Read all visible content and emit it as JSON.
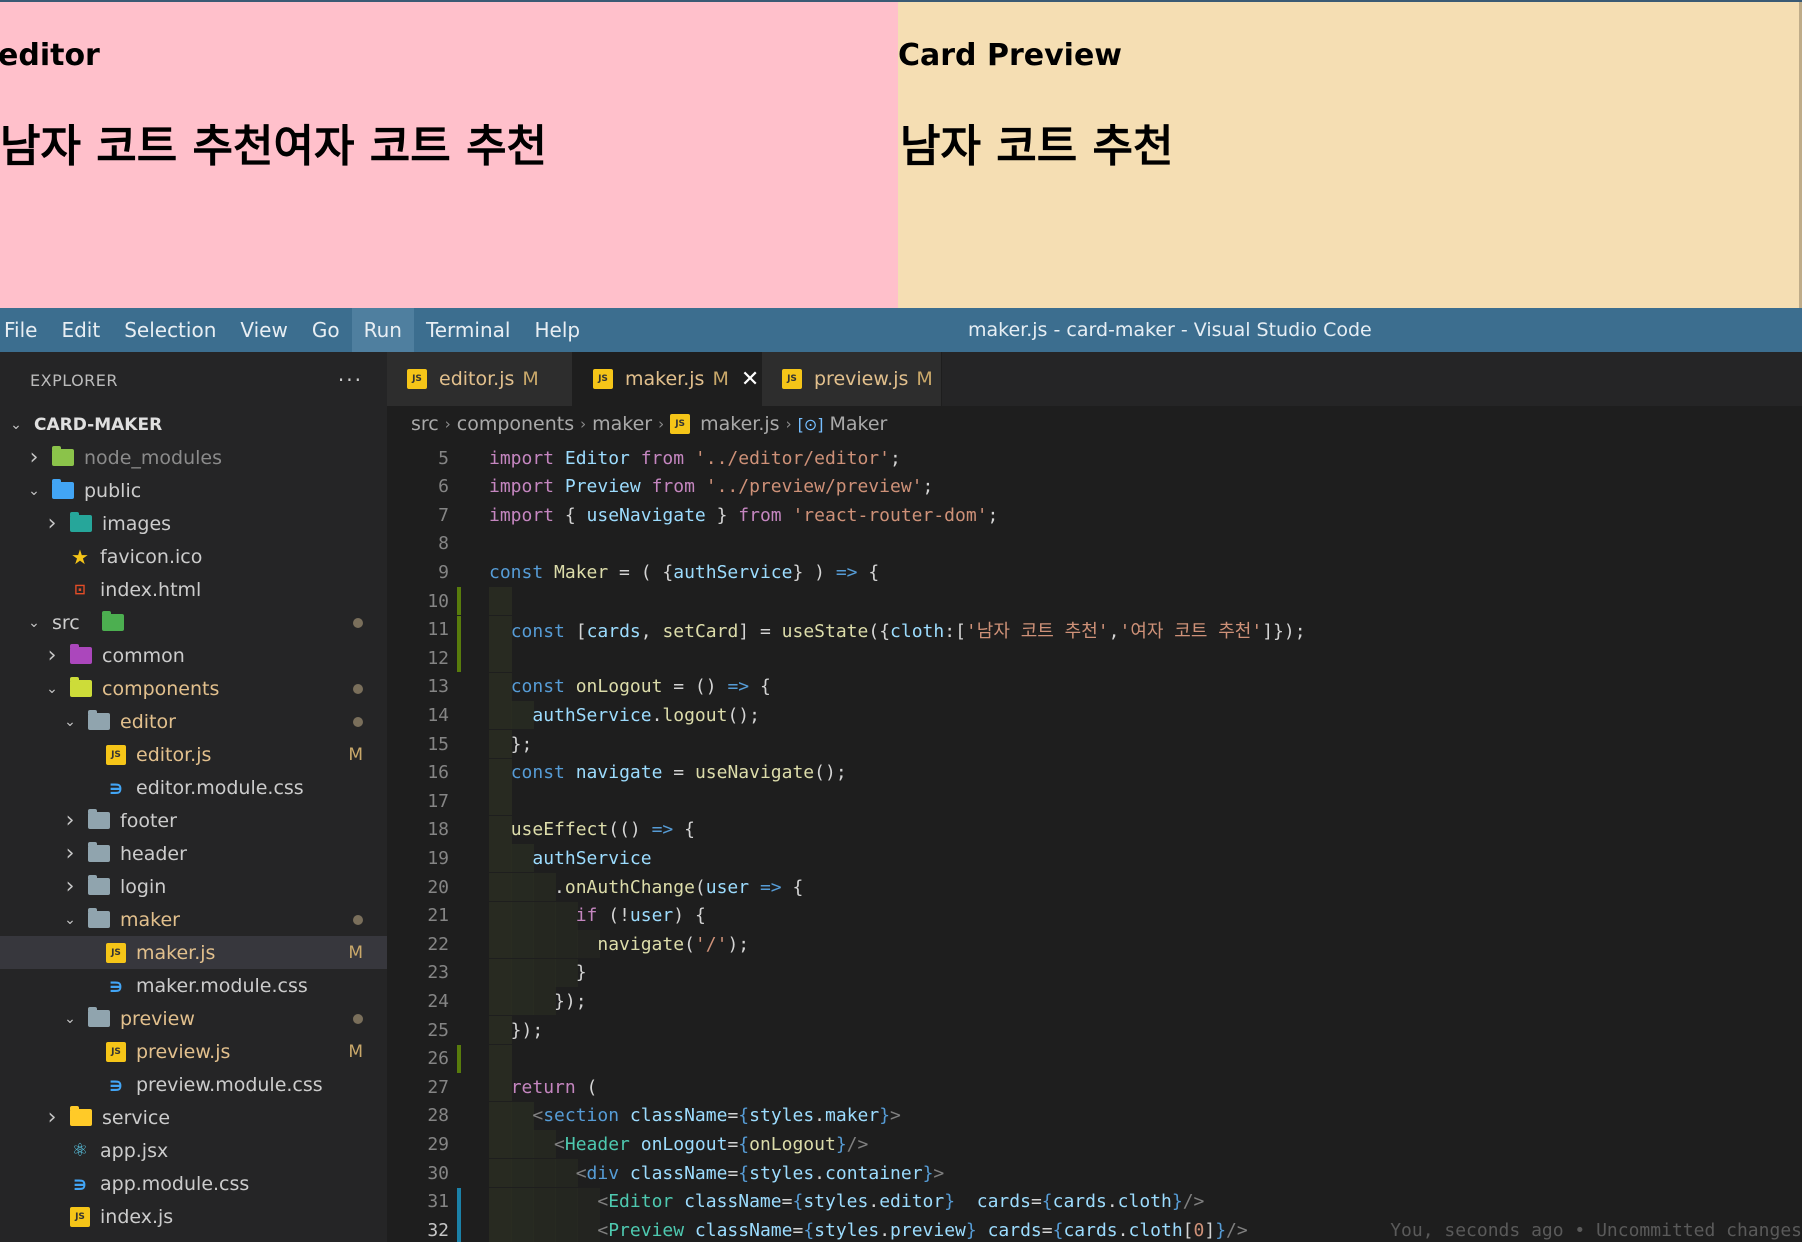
{
  "browser_preview": {
    "editor": {
      "heading": "editor",
      "content": "남자 코트 추천여자 코트 추천"
    },
    "preview": {
      "heading": "Card Preview",
      "content": "남자 코트 추천"
    }
  },
  "titlebar": {
    "menu": [
      "File",
      "Edit",
      "Selection",
      "View",
      "Go",
      "Run",
      "Terminal",
      "Help"
    ],
    "active_menu": "Run",
    "window_title": "maker.js - card-maker - Visual Studio Code"
  },
  "explorer": {
    "title": "EXPLORER",
    "more": "···",
    "root": "CARD-MAKER",
    "items": [
      {
        "label": "node_modules",
        "depth": 1,
        "kind": "folder",
        "color": "green",
        "expanded": false
      },
      {
        "label": "public",
        "depth": 1,
        "kind": "folder",
        "color": "blue",
        "expanded": true
      },
      {
        "label": "images",
        "depth": 2,
        "kind": "folder",
        "color": "teal",
        "expanded": false
      },
      {
        "label": "favicon.ico",
        "depth": 2,
        "kind": "star"
      },
      {
        "label": "index.html",
        "depth": 2,
        "kind": "html"
      },
      {
        "label": "src",
        "depth": 1,
        "kind": "folder",
        "color": "src",
        "expanded": true,
        "dot": true
      },
      {
        "label": "common",
        "depth": 2,
        "kind": "folder",
        "color": "purple",
        "expanded": false
      },
      {
        "label": "components",
        "depth": 2,
        "kind": "folder",
        "color": "yellow",
        "expanded": true,
        "dot": true,
        "modified_color": true
      },
      {
        "label": "editor",
        "depth": 3,
        "kind": "folder",
        "color": "plain",
        "expanded": true,
        "dot": true,
        "modified_color": true
      },
      {
        "label": "editor.js",
        "depth": 4,
        "kind": "js",
        "badge": "M",
        "modified_color": true
      },
      {
        "label": "editor.module.css",
        "depth": 4,
        "kind": "css"
      },
      {
        "label": "footer",
        "depth": 3,
        "kind": "folder",
        "color": "plain",
        "expanded": false
      },
      {
        "label": "header",
        "depth": 3,
        "kind": "folder",
        "color": "plain",
        "expanded": false
      },
      {
        "label": "login",
        "depth": 3,
        "kind": "folder",
        "color": "plain",
        "expanded": false
      },
      {
        "label": "maker",
        "depth": 3,
        "kind": "folder",
        "color": "plain",
        "expanded": true,
        "dot": true,
        "modified_color": true
      },
      {
        "label": "maker.js",
        "depth": 4,
        "kind": "js",
        "badge": "M",
        "modified_color": true,
        "selected": true
      },
      {
        "label": "maker.module.css",
        "depth": 4,
        "kind": "css"
      },
      {
        "label": "preview",
        "depth": 3,
        "kind": "folder",
        "color": "plain",
        "expanded": true,
        "dot": true,
        "modified_color": true
      },
      {
        "label": "preview.js",
        "depth": 4,
        "kind": "js",
        "badge": "M",
        "modified_color": true
      },
      {
        "label": "preview.module.css",
        "depth": 4,
        "kind": "css"
      },
      {
        "label": "service",
        "depth": 2,
        "kind": "folder",
        "color": "gold",
        "expanded": false
      },
      {
        "label": "app.jsx",
        "depth": 2,
        "kind": "react"
      },
      {
        "label": "app.module.css",
        "depth": 2,
        "kind": "css"
      },
      {
        "label": "index.js",
        "depth": 2,
        "kind": "js"
      }
    ]
  },
  "tabs": [
    {
      "label": "editor.js",
      "flag": "M",
      "active": false
    },
    {
      "label": "maker.js",
      "flag": "M",
      "active": true,
      "close": "✕"
    },
    {
      "label": "preview.js",
      "flag": "M",
      "active": false
    }
  ],
  "breadcrumb": {
    "parts": [
      "src",
      "components",
      "maker",
      "maker.js"
    ],
    "symbol": "Maker"
  },
  "code": {
    "current_line": 32,
    "blame": "You, seconds ago • Uncommitted changes",
    "lines": [
      {
        "n": 5,
        "tokens": [
          [
            "kw",
            "import "
          ],
          [
            "var",
            "Editor "
          ],
          [
            "kw",
            "from "
          ],
          [
            "str",
            "'../editor/editor'"
          ],
          [
            "pn",
            ";"
          ]
        ]
      },
      {
        "n": 6,
        "tokens": [
          [
            "kw",
            "import "
          ],
          [
            "var",
            "Preview "
          ],
          [
            "kw",
            "from "
          ],
          [
            "str",
            "'../preview/preview'"
          ],
          [
            "pn",
            ";"
          ]
        ]
      },
      {
        "n": 7,
        "tokens": [
          [
            "kw",
            "import "
          ],
          [
            "pn",
            "{ "
          ],
          [
            "var",
            "useNavigate"
          ],
          [
            "pn",
            " } "
          ],
          [
            "kw",
            "from "
          ],
          [
            "str",
            "'react-router-dom'"
          ],
          [
            "pn",
            ";"
          ]
        ]
      },
      {
        "n": 8,
        "tokens": []
      },
      {
        "n": 9,
        "tokens": [
          [
            "kd",
            "const "
          ],
          [
            "fn",
            "Maker"
          ],
          [
            "pn",
            " = ( {"
          ],
          [
            "var",
            "authService"
          ],
          [
            "pn",
            "} ) "
          ],
          [
            "kd",
            "=>"
          ],
          [
            "pn",
            " {"
          ]
        ]
      },
      {
        "n": 10,
        "tokens": []
      },
      {
        "n": 11,
        "tokens": [
          [
            "pn",
            "  "
          ],
          [
            "kd",
            "const "
          ],
          [
            "pn",
            "["
          ],
          [
            "var",
            "cards"
          ],
          [
            "pn",
            ", "
          ],
          [
            "fn",
            "setCard"
          ],
          [
            "pn",
            "] = "
          ],
          [
            "fn",
            "useState"
          ],
          [
            "pn",
            "({"
          ],
          [
            "var",
            "cloth"
          ],
          [
            "pn",
            ":["
          ],
          [
            "str",
            "'남자 코트 추천'"
          ],
          [
            "pn",
            ","
          ],
          [
            "str",
            "'여자 코트 추천'"
          ],
          [
            "pn",
            "]});"
          ]
        ]
      },
      {
        "n": 12,
        "tokens": []
      },
      {
        "n": 13,
        "tokens": [
          [
            "pn",
            "  "
          ],
          [
            "kd",
            "const "
          ],
          [
            "fn",
            "onLogout"
          ],
          [
            "pn",
            " = () "
          ],
          [
            "kd",
            "=>"
          ],
          [
            "pn",
            " {"
          ]
        ]
      },
      {
        "n": 14,
        "tokens": [
          [
            "pn",
            "    "
          ],
          [
            "var",
            "authService"
          ],
          [
            "pn",
            "."
          ],
          [
            "fn",
            "logout"
          ],
          [
            "pn",
            "();"
          ]
        ]
      },
      {
        "n": 15,
        "tokens": [
          [
            "pn",
            "  };"
          ]
        ]
      },
      {
        "n": 16,
        "tokens": [
          [
            "pn",
            "  "
          ],
          [
            "kd",
            "const "
          ],
          [
            "var",
            "navigate"
          ],
          [
            "pn",
            " = "
          ],
          [
            "fn",
            "useNavigate"
          ],
          [
            "pn",
            "();"
          ]
        ]
      },
      {
        "n": 17,
        "tokens": []
      },
      {
        "n": 18,
        "tokens": [
          [
            "pn",
            "  "
          ],
          [
            "fn",
            "useEffect"
          ],
          [
            "pn",
            "(() "
          ],
          [
            "kd",
            "=>"
          ],
          [
            "pn",
            " {"
          ]
        ]
      },
      {
        "n": 19,
        "tokens": [
          [
            "pn",
            "    "
          ],
          [
            "var",
            "authService"
          ]
        ]
      },
      {
        "n": 20,
        "tokens": [
          [
            "pn",
            "      ."
          ],
          [
            "fn",
            "onAuthChange"
          ],
          [
            "pn",
            "("
          ],
          [
            "var",
            "user"
          ],
          [
            "pn",
            " "
          ],
          [
            "kd",
            "=>"
          ],
          [
            "pn",
            " {"
          ]
        ]
      },
      {
        "n": 21,
        "tokens": [
          [
            "pn",
            "        "
          ],
          [
            "kw",
            "if"
          ],
          [
            "pn",
            " (!"
          ],
          [
            "var",
            "user"
          ],
          [
            "pn",
            ") {"
          ]
        ]
      },
      {
        "n": 22,
        "tokens": [
          [
            "pn",
            "          "
          ],
          [
            "fn",
            "navigate"
          ],
          [
            "pn",
            "("
          ],
          [
            "str",
            "'/'"
          ],
          [
            "pn",
            ");"
          ]
        ]
      },
      {
        "n": 23,
        "tokens": [
          [
            "pn",
            "        }"
          ]
        ]
      },
      {
        "n": 24,
        "tokens": [
          [
            "pn",
            "      });"
          ]
        ]
      },
      {
        "n": 25,
        "tokens": [
          [
            "pn",
            "  });"
          ]
        ]
      },
      {
        "n": 26,
        "tokens": []
      },
      {
        "n": 27,
        "tokens": [
          [
            "pn",
            "  "
          ],
          [
            "kw",
            "return"
          ],
          [
            "pn",
            " ("
          ]
        ]
      },
      {
        "n": 28,
        "tokens": [
          [
            "pn",
            "    "
          ],
          [
            "tag",
            "<"
          ],
          [
            "kd",
            "section "
          ],
          [
            "var",
            "className"
          ],
          [
            "pn",
            "="
          ],
          [
            "kd",
            "{"
          ],
          [
            "var",
            "styles"
          ],
          [
            "pn",
            "."
          ],
          [
            "var",
            "maker"
          ],
          [
            "kd",
            "}"
          ],
          [
            "tag",
            ">"
          ]
        ]
      },
      {
        "n": 29,
        "tokens": [
          [
            "pn",
            "      "
          ],
          [
            "tag",
            "<"
          ],
          [
            "cls",
            "Header "
          ],
          [
            "var",
            "onLogout"
          ],
          [
            "pn",
            "="
          ],
          [
            "kd",
            "{"
          ],
          [
            "fn",
            "onLogout"
          ],
          [
            "kd",
            "}"
          ],
          [
            "tag",
            "/>"
          ]
        ]
      },
      {
        "n": 30,
        "tokens": [
          [
            "pn",
            "        "
          ],
          [
            "tag",
            "<"
          ],
          [
            "kd",
            "div "
          ],
          [
            "var",
            "className"
          ],
          [
            "pn",
            "="
          ],
          [
            "kd",
            "{"
          ],
          [
            "var",
            "styles"
          ],
          [
            "pn",
            "."
          ],
          [
            "var",
            "container"
          ],
          [
            "kd",
            "}"
          ],
          [
            "tag",
            ">"
          ]
        ]
      },
      {
        "n": 31,
        "tokens": [
          [
            "pn",
            "          "
          ],
          [
            "tag",
            "<"
          ],
          [
            "cls",
            "Editor "
          ],
          [
            "var",
            "className"
          ],
          [
            "pn",
            "="
          ],
          [
            "kd",
            "{"
          ],
          [
            "var",
            "styles"
          ],
          [
            "pn",
            "."
          ],
          [
            "var",
            "editor"
          ],
          [
            "kd",
            "}"
          ],
          [
            "pn",
            "  "
          ],
          [
            "var",
            "cards"
          ],
          [
            "pn",
            "="
          ],
          [
            "kd",
            "{"
          ],
          [
            "var",
            "cards"
          ],
          [
            "pn",
            "."
          ],
          [
            "var",
            "cloth"
          ],
          [
            "kd",
            "}"
          ],
          [
            "tag",
            "/>"
          ]
        ]
      },
      {
        "n": 32,
        "tokens": [
          [
            "pn",
            "          "
          ],
          [
            "tag",
            "<"
          ],
          [
            "cls",
            "Preview "
          ],
          [
            "var",
            "className"
          ],
          [
            "pn",
            "="
          ],
          [
            "kd",
            "{"
          ],
          [
            "var",
            "styles"
          ],
          [
            "pn",
            "."
          ],
          [
            "var",
            "preview"
          ],
          [
            "kd",
            "}"
          ],
          [
            "pn",
            " "
          ],
          [
            "var",
            "cards"
          ],
          [
            "pn",
            "="
          ],
          [
            "kd",
            "{"
          ],
          [
            "var",
            "cards"
          ],
          [
            "pn",
            "."
          ],
          [
            "var",
            "cloth"
          ],
          [
            "pn",
            "["
          ],
          [
            "str",
            "0"
          ],
          [
            "pn",
            "]"
          ],
          [
            "kd",
            "}"
          ],
          [
            "tag",
            "/>"
          ]
        ]
      }
    ]
  }
}
